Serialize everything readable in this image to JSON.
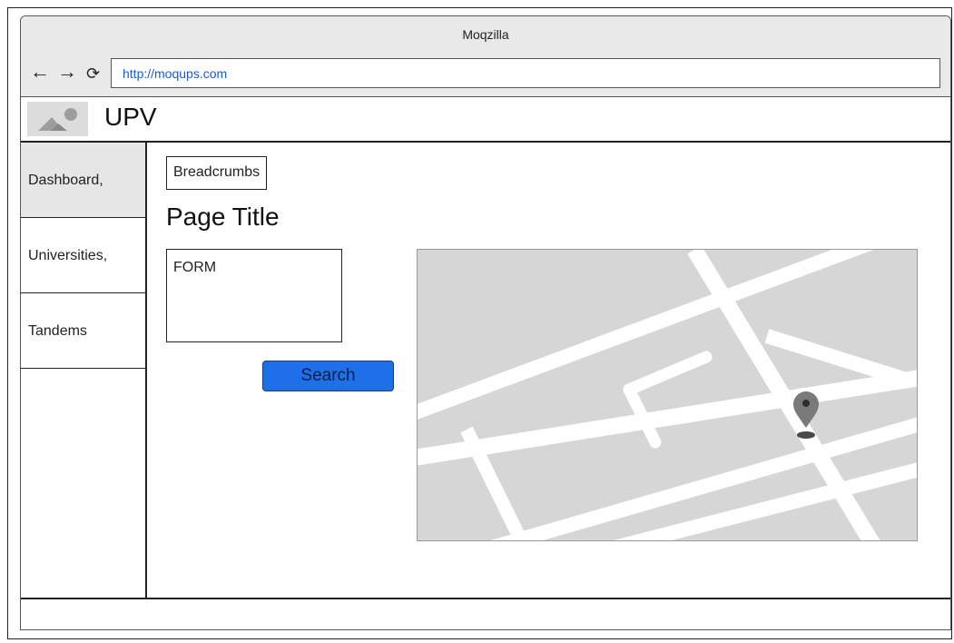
{
  "window": {
    "title": "Moqzilla"
  },
  "nav": {
    "back_icon": "←",
    "forward_icon": "→",
    "reload_icon": "⟳"
  },
  "address_bar": {
    "url": "http://moqups.com"
  },
  "header": {
    "brand": "UPV",
    "logo_icon": "image-placeholder-icon"
  },
  "sidebar": {
    "items": [
      {
        "label": "Dashboard,",
        "active": true
      },
      {
        "label": "Universities,",
        "active": false
      },
      {
        "label": "Tandems",
        "active": false
      }
    ]
  },
  "main": {
    "breadcrumbs": "Breadcrumbs",
    "page_title": "Page Title",
    "form_label": "FORM",
    "search_button": "Search"
  },
  "map": {
    "pin_icon": "map-pin-icon"
  },
  "colors": {
    "accent": "#1f6fe8",
    "url_text": "#1a5ad6",
    "map_bg": "#d6d6d6"
  }
}
